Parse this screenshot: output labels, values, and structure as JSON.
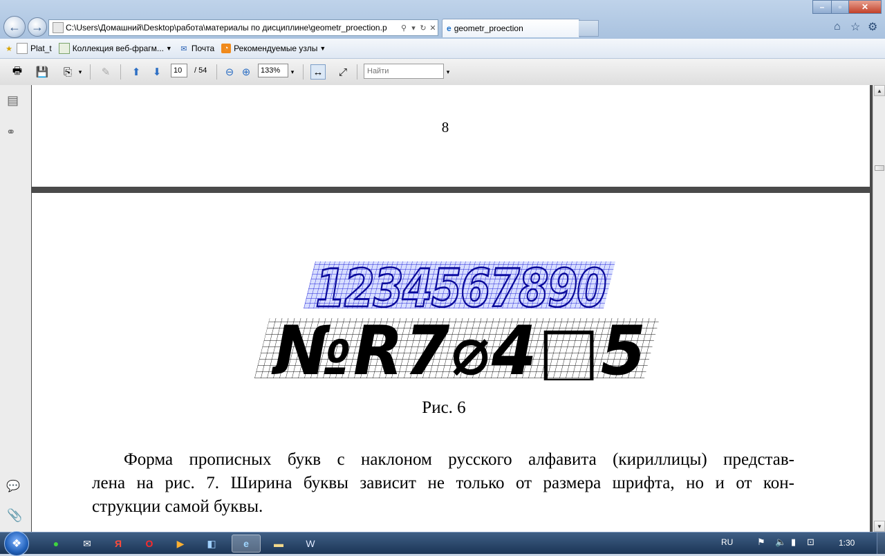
{
  "browser": {
    "address": "C:\\Users\\Домашний\\Desktop\\работа\\материалы по дисциплине\\geometr_proection.p",
    "tab_title": "geometr_proection"
  },
  "favorites": [
    {
      "label": "Plat_t",
      "icon": "favorite-page-icon"
    },
    {
      "label": "Коллекция веб-фрагм...",
      "icon": "web-slice-icon",
      "dropdown": true
    },
    {
      "label": "Почта",
      "icon": "mail-icon"
    },
    {
      "label": "Рекомендуемые узлы",
      "icon": "suggested-sites-icon",
      "dropdown": true
    }
  ],
  "pdf_toolbar": {
    "page_current": "10",
    "page_total": "/ 54",
    "zoom": "133%",
    "find_placeholder": "Найти"
  },
  "document": {
    "page_number": "8",
    "figure_top_line": "1234567890",
    "figure_bottom_line": "№R7⌀4□5",
    "figure_caption": "Рис. 6",
    "paragraph": "Форма прописных букв с наклоном  русского алфавита (кириллицы) представлена на рис. 7. Ширина буквы зависит не только от размера шрифта, но и от конструкции самой буквы.",
    "paragraph_lines": [
      "Форма прописных букв с наклоном  русского алфавита (кириллицы) представ-",
      "лена на рис. 7. Ширина буквы зависит не только от размера шрифта, но и от кон-",
      "струкции самой буквы."
    ]
  },
  "taskbar": {
    "language": "RU",
    "clock": "1:30"
  },
  "colors": {
    "figure_blue_grid": "#1a1ad6",
    "figure_blue_fill": "#d8deff",
    "figure_black": "#000000",
    "viewer_background": "#4a4a4a"
  }
}
